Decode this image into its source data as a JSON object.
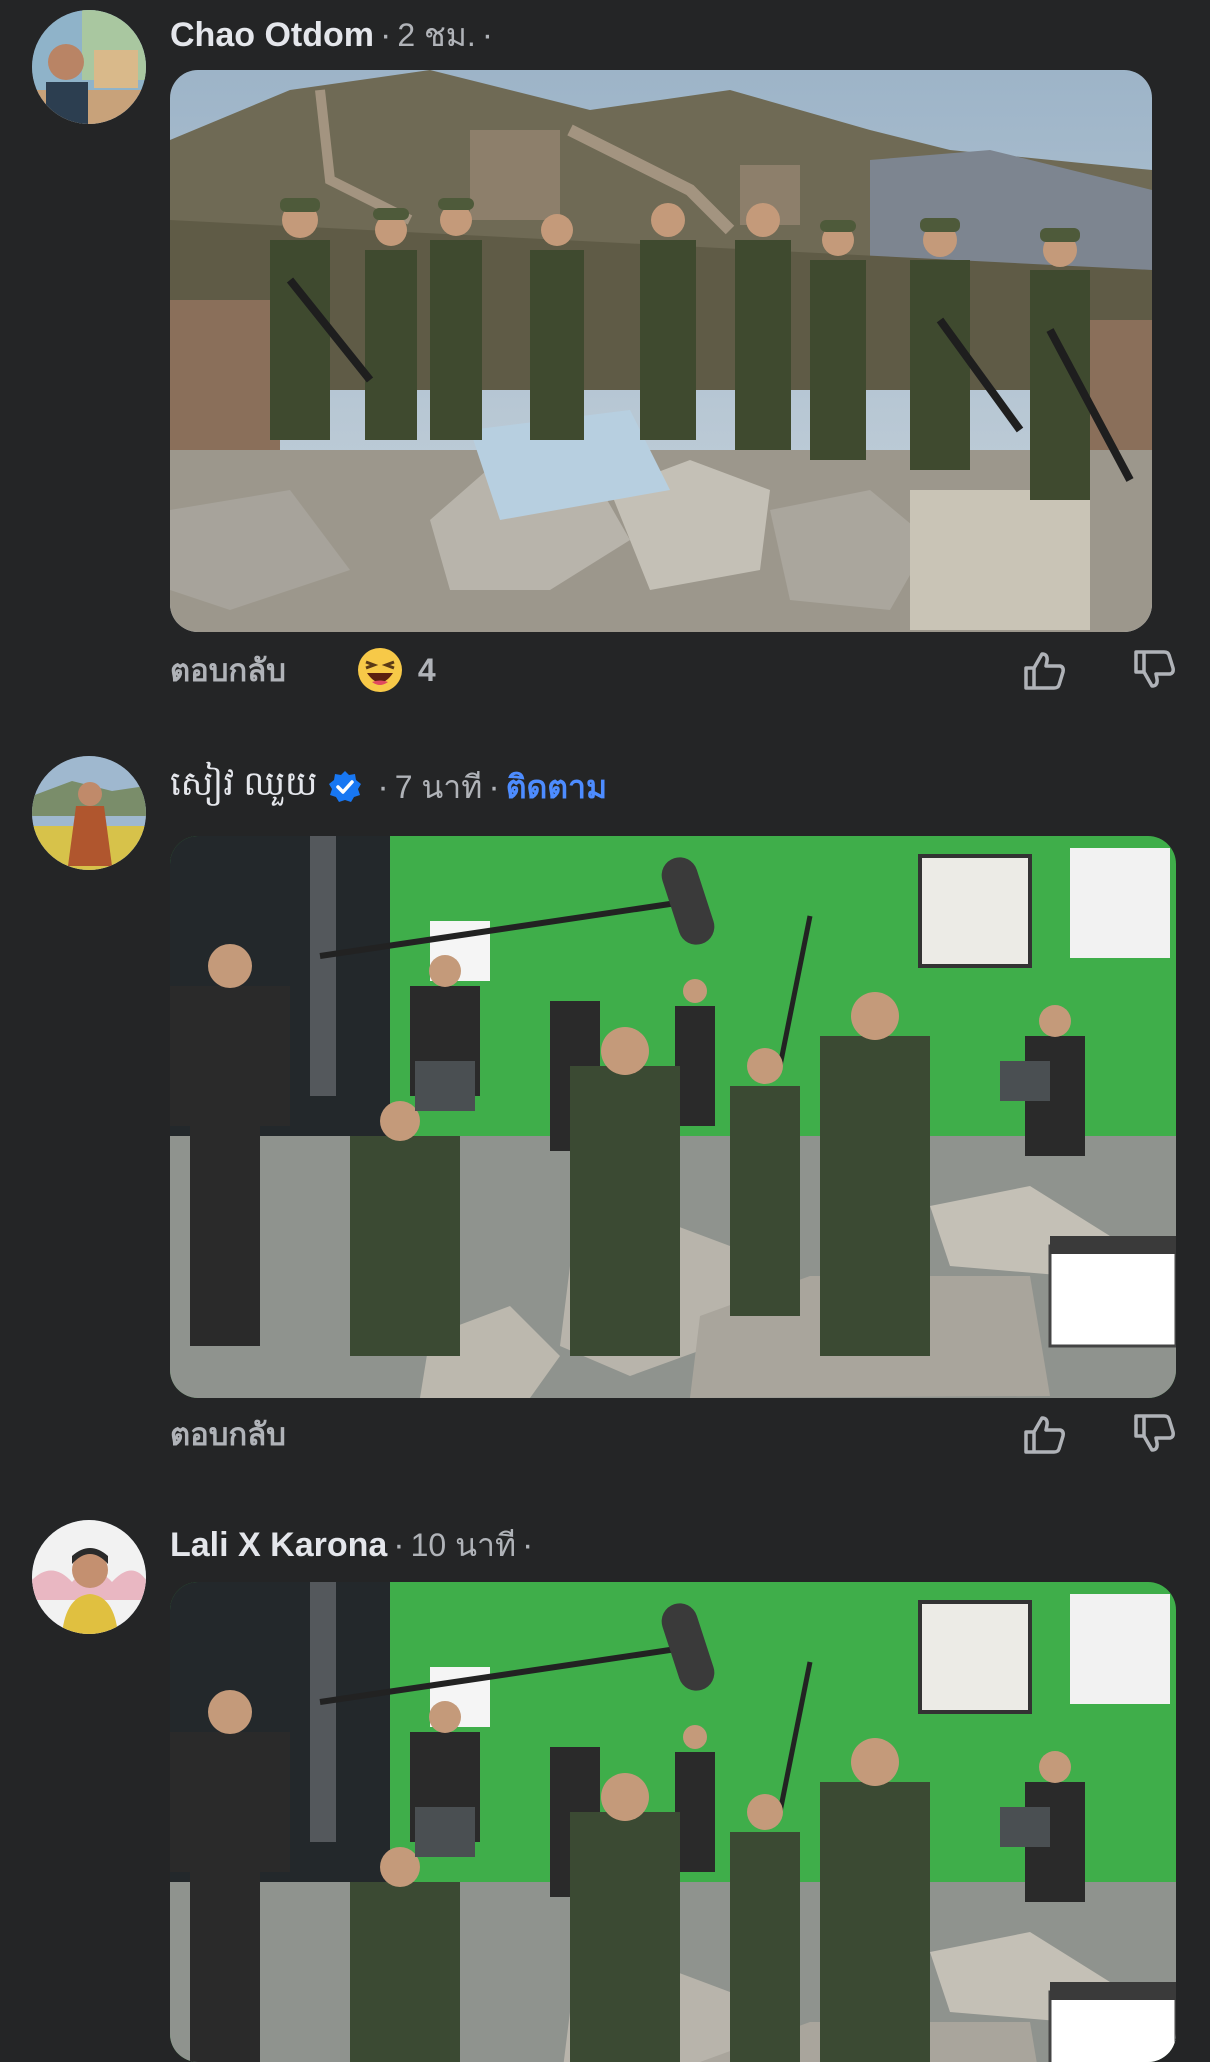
{
  "comments": [
    {
      "name": "Chao Otdom",
      "time": "2 ชม.",
      "reply_label": "ตอบกลับ",
      "reaction_count": "4",
      "reaction_icon": "laughing-emoji-icon",
      "avatar_icon": "user-avatar-icon"
    },
    {
      "name": "សៀវ ឈួយ",
      "verified": true,
      "time": "7 นาที",
      "follow_label": "ติดตาม",
      "reply_label": "ตอบกลับ",
      "avatar_icon": "user-avatar-icon"
    },
    {
      "name": "Lali X Karona",
      "time": "10 นาที",
      "avatar_icon": "user-avatar-icon"
    }
  ],
  "colors": {
    "background": "#242526",
    "text_primary": "#e4e6eb",
    "text_secondary": "#b0b3b8",
    "link": "#4d8cff",
    "verified": "#1877f2",
    "green_screen": "#3fae4a"
  }
}
